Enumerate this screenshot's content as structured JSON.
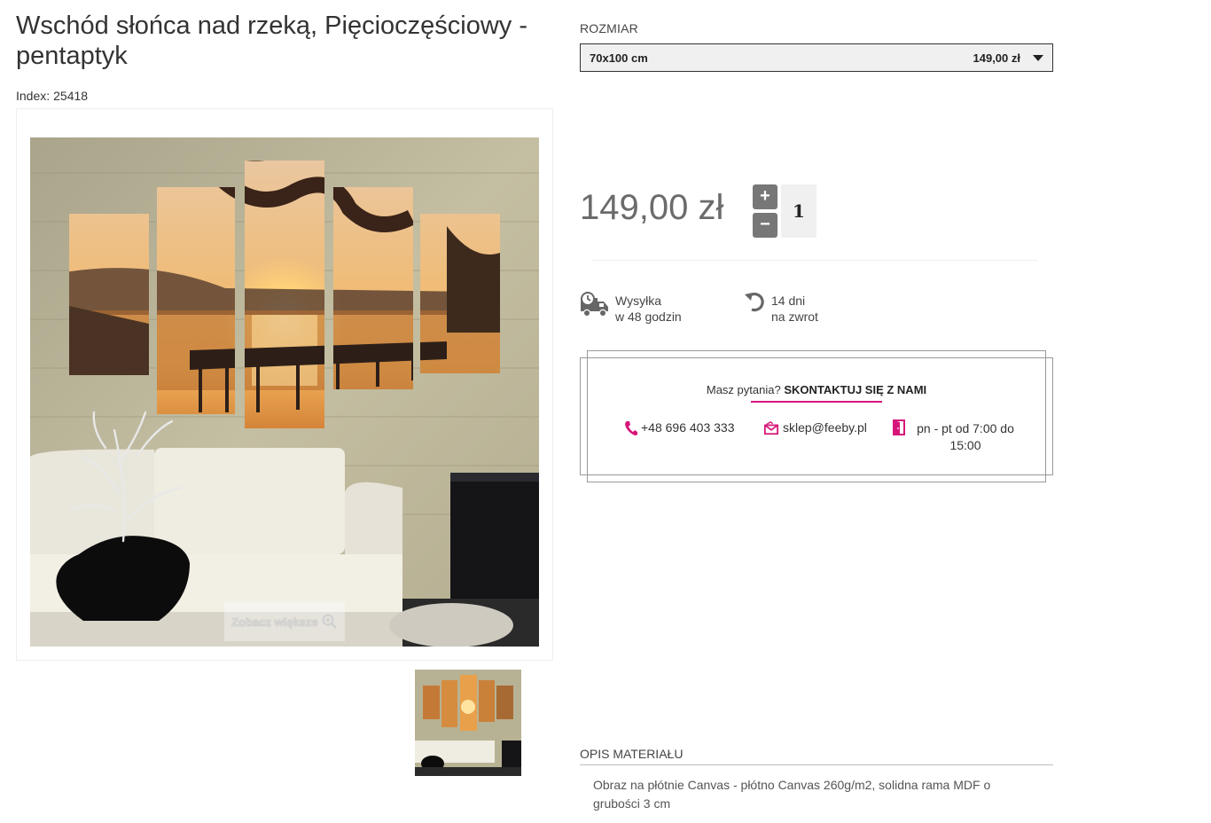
{
  "product": {
    "title": "Wschód słońca nad rzeką, Pięcioczęściowy - pentaptyk",
    "index_label": "Index:",
    "index_value": "25418",
    "zoom_label": "Zobacz większe"
  },
  "options": {
    "size_label": "ROZMIAR",
    "selected_size": "70x100 cm",
    "selected_price": "149,00 zł"
  },
  "pricing": {
    "price": "149,00 zł",
    "quantity": "1",
    "plus": "+",
    "minus": "−"
  },
  "perks": {
    "shipping_line1": "Wysyłka",
    "shipping_line2": "w 48 godzin",
    "return_line1": "14 dni",
    "return_line2": "na zwrot"
  },
  "contact": {
    "question": "Masz pytania?",
    "link": "SKONTAKTUJ SIĘ Z NAMI",
    "phone": "+48 696 403 333",
    "email": "sklep@feeby.pl",
    "hours": "pn - pt od 7:00 do 15:00"
  },
  "description": {
    "label": "OPIS MATERIAŁU",
    "text": "Obraz na płótnie Canvas - płótno Canvas 260g/m2, solidna rama MDF o grubości 3 cm"
  },
  "colors": {
    "accent": "#d6177a",
    "price": "#6b6b6b"
  }
}
